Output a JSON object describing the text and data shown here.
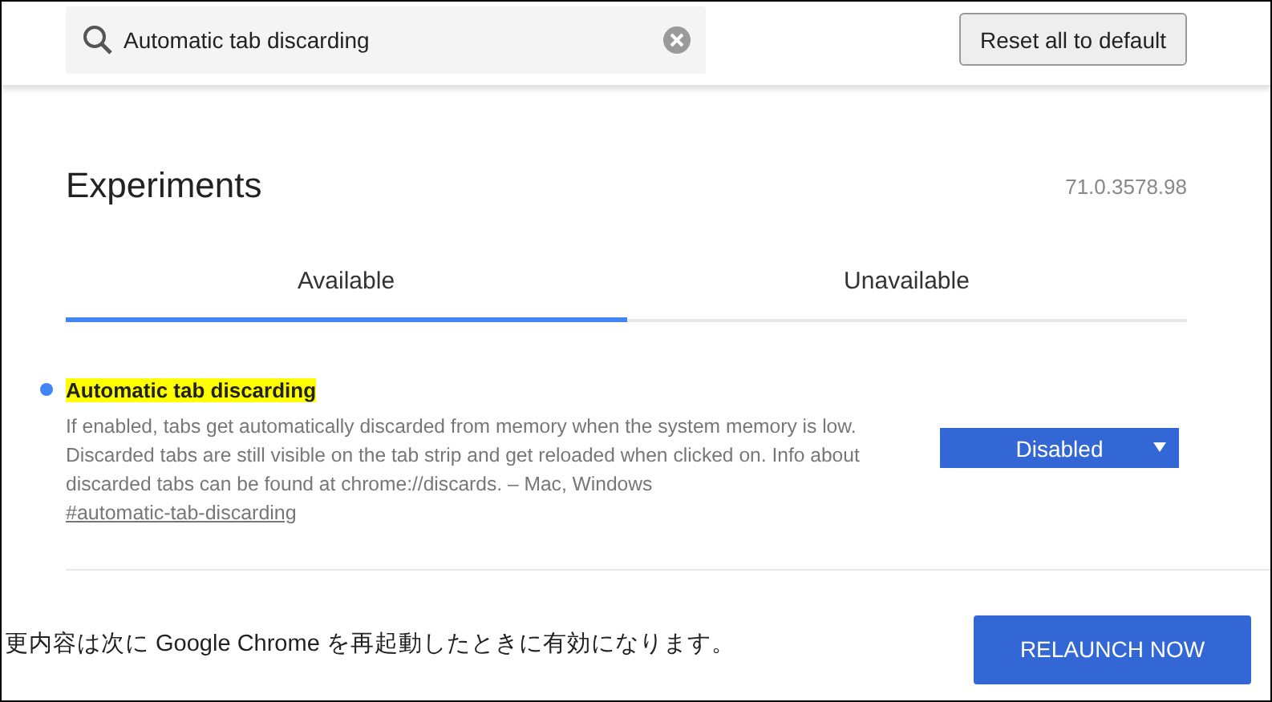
{
  "search": {
    "value": "Automatic tab discarding"
  },
  "reset_button": "Reset all to default",
  "title": "Experiments",
  "version": "71.0.3578.98",
  "tabs": [
    {
      "label": "Available",
      "selected": true
    },
    {
      "label": "Unavailable",
      "selected": false
    }
  ],
  "experiments": [
    {
      "name": "Automatic tab discarding",
      "highlighted": true,
      "description": "If enabled, tabs get automatically discarded from memory when the system memory is low. Discarded tabs are still visible on the tab strip and get reloaded when clicked on. Info about discarded tabs can be found at chrome://discards. – Mac, Windows",
      "link": "#automatic-tab-discarding",
      "value": "Disabled"
    }
  ],
  "relaunch": {
    "message": "更内容は次に Google Chrome を再起動したときに有効になります。",
    "button": "RELAUNCH NOW"
  }
}
